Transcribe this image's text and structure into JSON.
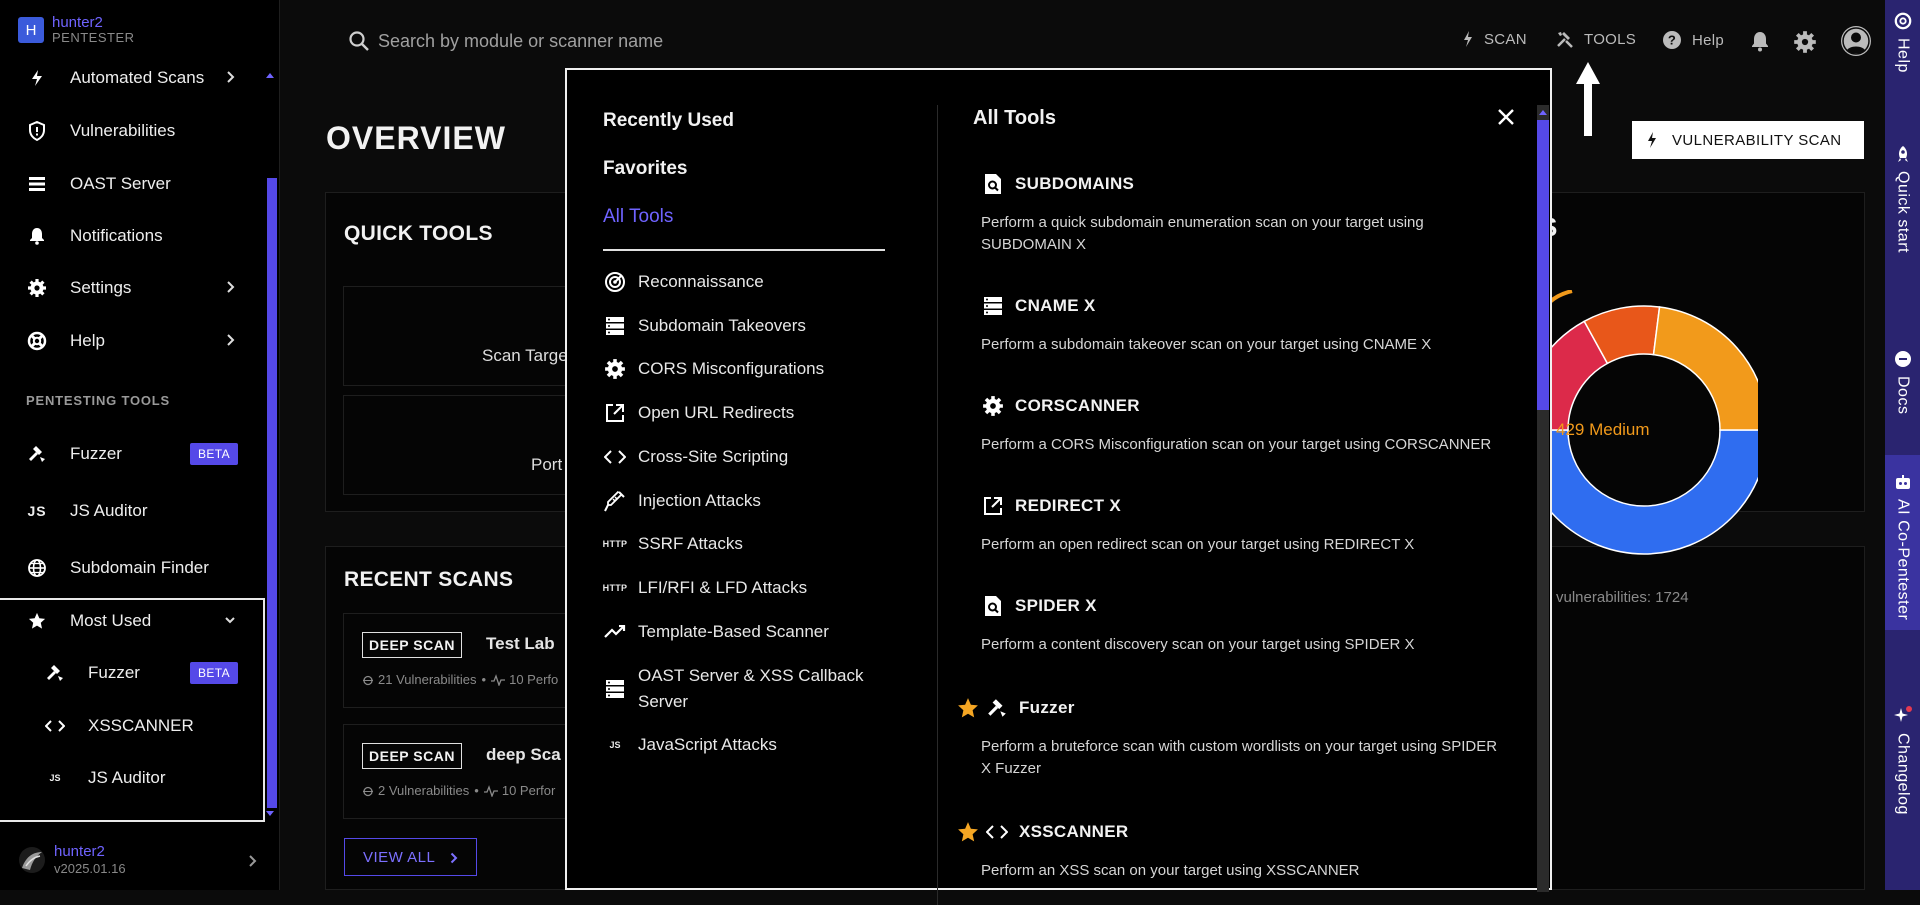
{
  "sidebar": {
    "brand_initial": "H",
    "brand_user": "hunter2",
    "brand_role": "PENTESTER",
    "items": [
      {
        "label": "Automated Scans"
      },
      {
        "label": "Vulnerabilities"
      },
      {
        "label": "OAST Server"
      },
      {
        "label": "Notifications"
      },
      {
        "label": "Settings"
      },
      {
        "label": "Help"
      }
    ],
    "section_label": "PENTESTING TOOLS",
    "tools": [
      {
        "label": "Fuzzer",
        "badge": "BETA"
      },
      {
        "label": "JS Auditor"
      },
      {
        "label": "Subdomain Finder"
      }
    ],
    "most_used": {
      "label": "Most Used",
      "items": [
        {
          "label": "Fuzzer",
          "badge": "BETA"
        },
        {
          "label": "XSSCANNER"
        },
        {
          "label": "JS Auditor"
        }
      ]
    },
    "footer": {
      "user": "hunter2",
      "version": "v2025.01.16"
    }
  },
  "topbar": {
    "search_placeholder": "Search by module or scanner name",
    "scan_label": "SCAN",
    "tools_label": "TOOLS",
    "help_label": "Help"
  },
  "page": {
    "title": "OVERVIEW",
    "quick_tools_title": "QUICK TOOLS",
    "quick_tiles": [
      "Scan Targe",
      "Port"
    ],
    "recent_scans_title": "RECENT SCANS",
    "recent_scans": [
      {
        "badge": "DEEP SCAN",
        "name": "Test Lab",
        "vulns": "21 Vulnerabilities",
        "perf": "10 Perfo"
      },
      {
        "badge": "DEEP SCAN",
        "name": "deep Sca",
        "vulns": "2 Vulnerabilities",
        "perf": "10 Perfor"
      }
    ],
    "view_all": "VIEW ALL",
    "vuln_scan_button": "VULNERABILITY SCAN",
    "chart_partial_title": "S",
    "donut_center_label": "429 Medium",
    "vulns_total_label": "vulnerabilities: 1724"
  },
  "chart_data": {
    "type": "pie",
    "title": "",
    "center_label": "429 Medium",
    "total_label": "vulnerabilities: 1724",
    "slices": [
      {
        "color": "#2f6df0",
        "value": 0.5
      },
      {
        "color": "#dc2a4a",
        "value": 0.17
      },
      {
        "color": "#e8571a",
        "value": 0.1
      },
      {
        "color": "#f29a1b",
        "value": 0.23
      }
    ]
  },
  "right_rail": [
    "Help",
    "Quick start",
    "Docs",
    "AI Co-Pentester",
    "Changelog"
  ],
  "modal": {
    "nav": [
      "Recently Used",
      "Favorites",
      "All Tools"
    ],
    "categories": [
      {
        "label": "Reconnaissance",
        "icon": "target-icon"
      },
      {
        "label": "Subdomain Takeovers",
        "icon": "server-icon"
      },
      {
        "label": "CORS Misconfigurations",
        "icon": "gear-icon"
      },
      {
        "label": "Open URL Redirects",
        "icon": "external-link-icon"
      },
      {
        "label": "Cross-Site Scripting",
        "icon": "code-icon"
      },
      {
        "label": "Injection Attacks",
        "icon": "syringe-icon"
      },
      {
        "label": "SSRF Attacks",
        "icon": "http-icon"
      },
      {
        "label": "LFI/RFI & LFD Attacks",
        "icon": "http-icon"
      },
      {
        "label": "Template-Based Scanner",
        "icon": "trend-icon"
      },
      {
        "label": "OAST Server & XSS Callback Server",
        "icon": "server-icon"
      },
      {
        "label": "JavaScript Attacks",
        "icon": "js-icon"
      }
    ],
    "heading": "All Tools",
    "tools": [
      {
        "name": "SUBDOMAINS",
        "desc": "Perform a quick subdomain enumeration scan on your target using SUBDOMAIN X",
        "icon": "page-search-icon",
        "fav": false
      },
      {
        "name": "CNAME X",
        "desc": "Perform a subdomain takeover scan on your target using CNAME X",
        "icon": "server-icon",
        "fav": false
      },
      {
        "name": "CORSCANNER",
        "desc": "Perform a CORS Misconfiguration scan on your target using CORSCANNER",
        "icon": "gear-icon",
        "fav": false
      },
      {
        "name": "REDIRECT X",
        "desc": "Perform an open redirect scan on your target using REDIRECT X",
        "icon": "external-link-icon",
        "fav": false
      },
      {
        "name": "SPIDER X",
        "desc": "Perform a content discovery scan on your target using SPIDER X",
        "icon": "page-search-icon",
        "fav": false
      },
      {
        "name": "Fuzzer",
        "desc": "Perform a bruteforce scan with custom wordlists on your target using SPIDER X Fuzzer",
        "icon": "hammer-icon",
        "fav": true
      },
      {
        "name": "XSSCANNER",
        "desc": "Perform an XSS scan on your target using XSSCANNER",
        "icon": "code-icon",
        "fav": true
      }
    ]
  }
}
